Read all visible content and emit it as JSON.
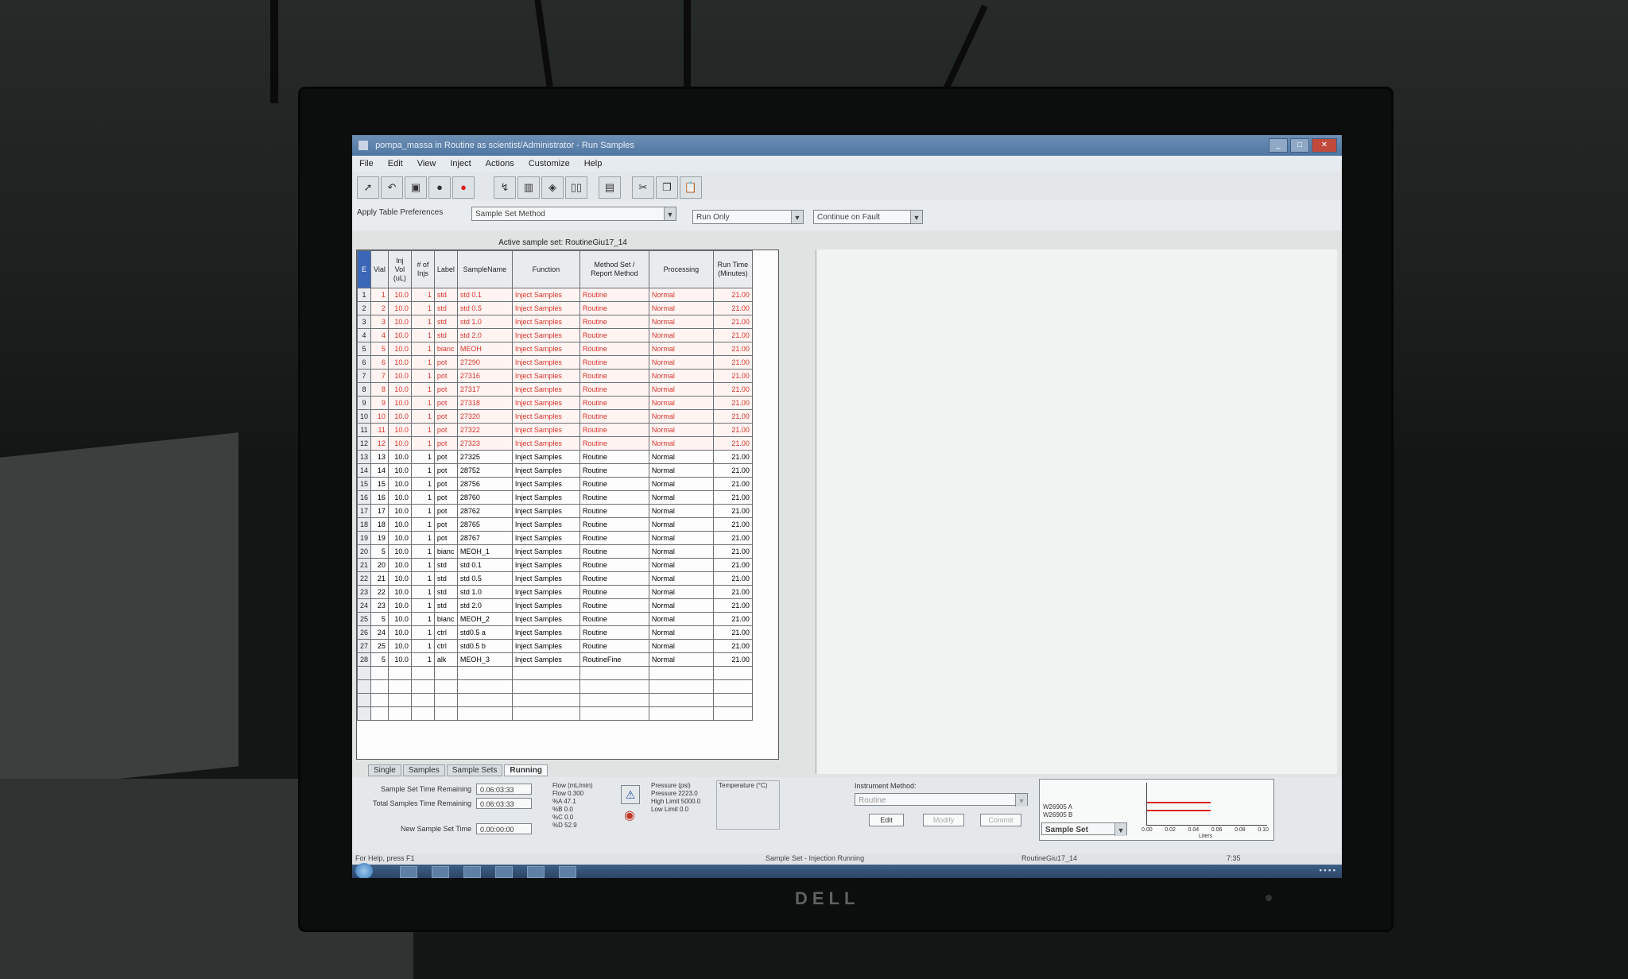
{
  "window": {
    "title": "pompa_massa in Routine as scientist/Administrator - Run Samples",
    "controls": [
      "_",
      "□",
      "✕"
    ]
  },
  "menu": [
    "File",
    "Edit",
    "View",
    "Inject",
    "Actions",
    "Customize",
    "Help"
  ],
  "toolbar_icons": [
    "pointer-icon",
    "undo-icon",
    "save-icon",
    "stop-icon",
    "record-icon",
    "inject-icon",
    "vial-icon",
    "tray-icon",
    "columns-icon",
    "table-icon",
    "cut-icon",
    "copy-icon",
    "paste-icon"
  ],
  "preferences": {
    "label": "Apply Table Preferences",
    "table_pref": "Sample Set Method",
    "run_mode": "Run Only",
    "fault_mode": "Continue on Fault"
  },
  "table": {
    "caption": "Active sample set:  RoutineGiu17_14",
    "corner": "E",
    "headers": [
      "Vial",
      "Inj Vol (uL)",
      "# of Injs",
      "Label",
      "SampleName",
      "Function",
      "Method Set / Report Method",
      "Processing",
      "Run Time (Minutes)"
    ],
    "rows": [
      {
        "n": "1",
        "vial": "1",
        "vol": "10.0",
        "injs": "1",
        "label": "std",
        "name": "std 0.1",
        "func": "Inject Samples",
        "method": "Routine",
        "proc": "Normal",
        "time": "21.00",
        "done": true
      },
      {
        "n": "2",
        "vial": "2",
        "vol": "10.0",
        "injs": "1",
        "label": "std",
        "name": "std 0.5",
        "func": "Inject Samples",
        "method": "Routine",
        "proc": "Normal",
        "time": "21.00",
        "done": true
      },
      {
        "n": "3",
        "vial": "3",
        "vol": "10.0",
        "injs": "1",
        "label": "std",
        "name": "std 1.0",
        "func": "Inject Samples",
        "method": "Routine",
        "proc": "Normal",
        "time": "21.00",
        "done": true
      },
      {
        "n": "4",
        "vial": "4",
        "vol": "10.0",
        "injs": "1",
        "label": "std",
        "name": "std 2.0",
        "func": "Inject Samples",
        "method": "Routine",
        "proc": "Normal",
        "time": "21.00",
        "done": true
      },
      {
        "n": "5",
        "vial": "5",
        "vol": "10.0",
        "injs": "1",
        "label": "bianc",
        "name": "MEOH",
        "func": "Inject Samples",
        "method": "Routine",
        "proc": "Normal",
        "time": "21.00",
        "done": true
      },
      {
        "n": "6",
        "vial": "6",
        "vol": "10.0",
        "injs": "1",
        "label": "pot",
        "name": "27290",
        "func": "Inject Samples",
        "method": "Routine",
        "proc": "Normal",
        "time": "21.00",
        "done": true
      },
      {
        "n": "7",
        "vial": "7",
        "vol": "10.0",
        "injs": "1",
        "label": "pot",
        "name": "27316",
        "func": "Inject Samples",
        "method": "Routine",
        "proc": "Normal",
        "time": "21.00",
        "done": true
      },
      {
        "n": "8",
        "vial": "8",
        "vol": "10.0",
        "injs": "1",
        "label": "pot",
        "name": "27317",
        "func": "Inject Samples",
        "method": "Routine",
        "proc": "Normal",
        "time": "21.00",
        "done": true
      },
      {
        "n": "9",
        "vial": "9",
        "vol": "10.0",
        "injs": "1",
        "label": "pot",
        "name": "27318",
        "func": "Inject Samples",
        "method": "Routine",
        "proc": "Normal",
        "time": "21.00",
        "done": true
      },
      {
        "n": "10",
        "vial": "10",
        "vol": "10.0",
        "injs": "1",
        "label": "pot",
        "name": "27320",
        "func": "Inject Samples",
        "method": "Routine",
        "proc": "Normal",
        "time": "21.00",
        "done": true
      },
      {
        "n": "11",
        "vial": "11",
        "vol": "10.0",
        "injs": "1",
        "label": "pot",
        "name": "27322",
        "func": "Inject Samples",
        "method": "Routine",
        "proc": "Normal",
        "time": "21.00",
        "done": true
      },
      {
        "n": "12",
        "vial": "12",
        "vol": "10.0",
        "injs": "1",
        "label": "pot",
        "name": "27323",
        "func": "Inject Samples",
        "method": "Routine",
        "proc": "Normal",
        "time": "21.00",
        "done": true
      },
      {
        "n": "13",
        "vial": "13",
        "vol": "10.0",
        "injs": "1",
        "label": "pot",
        "name": "27325",
        "func": "Inject Samples",
        "method": "Routine",
        "proc": "Normal",
        "time": "21.00",
        "done": false
      },
      {
        "n": "14",
        "vial": "14",
        "vol": "10.0",
        "injs": "1",
        "label": "pot",
        "name": "28752",
        "func": "Inject Samples",
        "method": "Routine",
        "proc": "Normal",
        "time": "21.00",
        "done": false
      },
      {
        "n": "15",
        "vial": "15",
        "vol": "10.0",
        "injs": "1",
        "label": "pot",
        "name": "28756",
        "func": "Inject Samples",
        "method": "Routine",
        "proc": "Normal",
        "time": "21.00",
        "done": false
      },
      {
        "n": "16",
        "vial": "16",
        "vol": "10.0",
        "injs": "1",
        "label": "pot",
        "name": "28760",
        "func": "Inject Samples",
        "method": "Routine",
        "proc": "Normal",
        "time": "21.00",
        "done": false
      },
      {
        "n": "17",
        "vial": "17",
        "vol": "10.0",
        "injs": "1",
        "label": "pot",
        "name": "28762",
        "func": "Inject Samples",
        "method": "Routine",
        "proc": "Normal",
        "time": "21.00",
        "done": false
      },
      {
        "n": "18",
        "vial": "18",
        "vol": "10.0",
        "injs": "1",
        "label": "pot",
        "name": "28765",
        "func": "Inject Samples",
        "method": "Routine",
        "proc": "Normal",
        "time": "21.00",
        "done": false
      },
      {
        "n": "19",
        "vial": "19",
        "vol": "10.0",
        "injs": "1",
        "label": "pot",
        "name": "28767",
        "func": "Inject Samples",
        "method": "Routine",
        "proc": "Normal",
        "time": "21.00",
        "done": false
      },
      {
        "n": "20",
        "vial": "5",
        "vol": "10.0",
        "injs": "1",
        "label": "bianc",
        "name": "MEOH_1",
        "func": "Inject Samples",
        "method": "Routine",
        "proc": "Normal",
        "time": "21.00",
        "done": false
      },
      {
        "n": "21",
        "vial": "20",
        "vol": "10.0",
        "injs": "1",
        "label": "std",
        "name": "std 0.1",
        "func": "Inject Samples",
        "method": "Routine",
        "proc": "Normal",
        "time": "21.00",
        "done": false
      },
      {
        "n": "22",
        "vial": "21",
        "vol": "10.0",
        "injs": "1",
        "label": "std",
        "name": "std 0.5",
        "func": "Inject Samples",
        "method": "Routine",
        "proc": "Normal",
        "time": "21.00",
        "done": false
      },
      {
        "n": "23",
        "vial": "22",
        "vol": "10.0",
        "injs": "1",
        "label": "std",
        "name": "std 1.0",
        "func": "Inject Samples",
        "method": "Routine",
        "proc": "Normal",
        "time": "21.00",
        "done": false
      },
      {
        "n": "24",
        "vial": "23",
        "vol": "10.0",
        "injs": "1",
        "label": "std",
        "name": "std 2.0",
        "func": "Inject Samples",
        "method": "Routine",
        "proc": "Normal",
        "time": "21.00",
        "done": false
      },
      {
        "n": "25",
        "vial": "5",
        "vol": "10.0",
        "injs": "1",
        "label": "bianc",
        "name": "MEOH_2",
        "func": "Inject Samples",
        "method": "Routine",
        "proc": "Normal",
        "time": "21.00",
        "done": false
      },
      {
        "n": "26",
        "vial": "24",
        "vol": "10.0",
        "injs": "1",
        "label": "ctrl",
        "name": "std0.5 a",
        "func": "Inject Samples",
        "method": "Routine",
        "proc": "Normal",
        "time": "21.00",
        "done": false
      },
      {
        "n": "27",
        "vial": "25",
        "vol": "10.0",
        "injs": "1",
        "label": "ctrl",
        "name": "std0.5 b",
        "func": "Inject Samples",
        "method": "Routine",
        "proc": "Normal",
        "time": "21.00",
        "done": false
      },
      {
        "n": "28",
        "vial": "5",
        "vol": "10.0",
        "injs": "1",
        "label": "alk",
        "name": "MEOH_3",
        "func": "Inject Samples",
        "method": "RoutineFine",
        "proc": "Normal",
        "time": "21.00",
        "done": false
      }
    ],
    "empty_rows": 4
  },
  "tabs": [
    "Single",
    "Samples",
    "Sample Sets",
    "Running"
  ],
  "active_tab": "Running",
  "status": {
    "set_time_label": "Sample Set Time Remaining",
    "set_time": "0.06:03:33",
    "total_time_label": "Total Samples Time Remaining",
    "total_time": "0.06:03:33",
    "new_time_label": "New Sample Set Time",
    "new_time": "0.00:00:00",
    "flow_title": "Flow (mL/min)",
    "flow": "Flow  0.300",
    "pctA": "%A  47.1",
    "pctB": "%B  0.0",
    "pctC": "%C  0.0",
    "pctD": "%D  52.9",
    "pressure_title": "Pressure (psi)",
    "pressure": "Pressure  2223.0",
    "high_limit": "High Limit 5000.0",
    "low_limit": "Low Limit  0.0",
    "temperature_title": "Temperature (°C)",
    "instrument_method_label": "Instrument Method:",
    "instrument_method": "Routine",
    "edit_btn": "Edit",
    "btn2": "Modify",
    "btn3": "Commit",
    "detector_a": "W26905 A",
    "detector_b": "W26905 B",
    "view_select": "Sample Set",
    "x_ticks": [
      "0.00",
      "0.02",
      "0.04",
      "0.06",
      "0.08",
      "0.10"
    ],
    "x_unit": "Liters"
  },
  "statusbar": {
    "help": "For Help, press F1",
    "state": "Sample Set - Injection Running",
    "set_name": "RoutineGiu17_14",
    "extra": "7:35"
  },
  "monitor_brand": "DELL"
}
